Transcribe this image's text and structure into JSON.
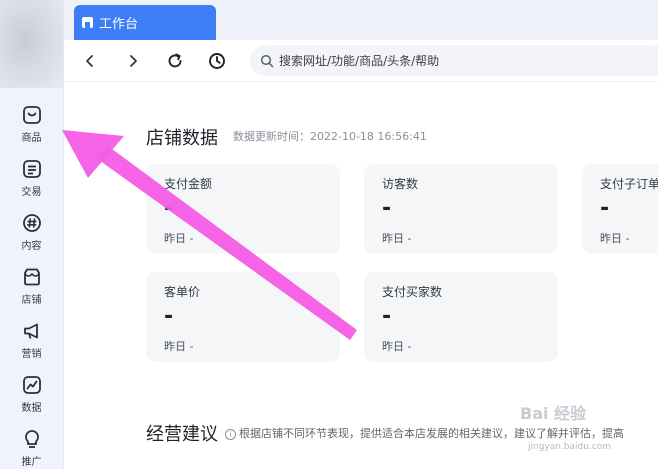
{
  "tabs": [
    {
      "label": "工作台"
    }
  ],
  "search": {
    "placeholder": "搜索网址/功能/商品/头条/帮助"
  },
  "sidebar": {
    "items": [
      {
        "label": "商品",
        "icon": "bag-icon"
      },
      {
        "label": "交易",
        "icon": "document-icon"
      },
      {
        "label": "内容",
        "icon": "hash-icon"
      },
      {
        "label": "店铺",
        "icon": "store-icon"
      },
      {
        "label": "营销",
        "icon": "megaphone-icon"
      },
      {
        "label": "数据",
        "icon": "chart-icon"
      },
      {
        "label": "推广",
        "icon": "bulb-icon"
      }
    ]
  },
  "store_data": {
    "title": "店铺数据",
    "update_time": "数据更新时间：2022-10-18 16:56:41",
    "cards": [
      {
        "label": "支付金额",
        "value": "-",
        "prev": "昨日 -"
      },
      {
        "label": "访客数",
        "value": "-",
        "prev": "昨日 -"
      },
      {
        "label": "支付子订单",
        "value": "-",
        "prev": "昨日 -"
      },
      {
        "label": "客单价",
        "value": "-",
        "prev": "昨日 -"
      },
      {
        "label": "支付买家数",
        "value": "-",
        "prev": "昨日 -"
      }
    ]
  },
  "advice": {
    "title": "经营建议",
    "desc": "根据店铺不同环节表现，提供适合本店发展的相关建议，建议了解并评估，提高"
  },
  "watermark": {
    "text": "Bai 经验",
    "sub": "jingyan.baidu.com"
  },
  "colors": {
    "accent": "#3d7df6",
    "annotation_arrow": "#f45ce6",
    "sidebar_bg": "#eef3fc"
  }
}
